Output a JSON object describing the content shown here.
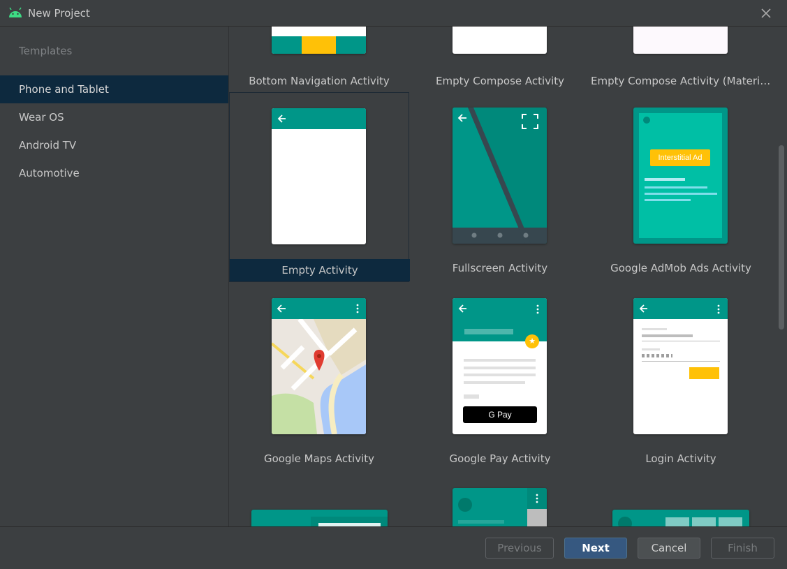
{
  "window": {
    "title": "New Project"
  },
  "sidebar": {
    "header": "Templates",
    "items": [
      {
        "label": "Phone and Tablet",
        "selected": true
      },
      {
        "label": "Wear OS"
      },
      {
        "label": "Android TV"
      },
      {
        "label": "Automotive"
      }
    ]
  },
  "templates": [
    {
      "label": "Bottom Navigation Activity"
    },
    {
      "label": "Empty Compose Activity"
    },
    {
      "label": "Empty Compose Activity (Material..."
    },
    {
      "label": "Empty Activity",
      "selected": true
    },
    {
      "label": "Fullscreen Activity"
    },
    {
      "label": "Google AdMob Ads Activity",
      "ad_badge": "Interstitial Ad"
    },
    {
      "label": "Google Maps Activity"
    },
    {
      "label": "Google Pay Activity",
      "pay_button": "G Pay"
    },
    {
      "label": "Login Activity"
    }
  ],
  "footer": {
    "previous": "Previous",
    "next": "Next",
    "cancel": "Cancel",
    "finish": "Finish"
  },
  "colors": {
    "teal_dark": "#00897b",
    "teal": "#009688",
    "teal_light": "#00bfa5",
    "amber": "#ffc107",
    "selection": "#0d293e",
    "primary_button": "#365880"
  }
}
